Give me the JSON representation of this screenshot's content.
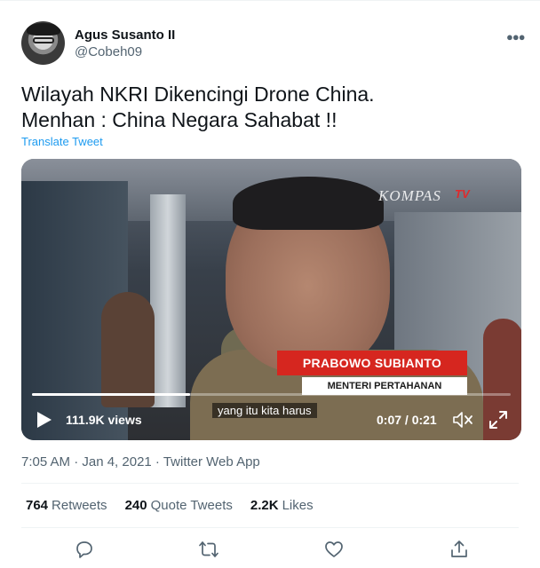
{
  "author": {
    "display_name": "Agus Susanto II",
    "handle": "@Cobeh09",
    "more_icon": "more-horizontal-icon"
  },
  "tweet": {
    "text": "Wilayah NKRI Dikencingi Drone China.\nMenhan : China Negara Sahabat !!",
    "translate_label": "Translate Tweet"
  },
  "video": {
    "channel_logo": "KOMPAS",
    "channel_logo_suffix": "TV",
    "lower_third_name": "PRABOWO SUBIANTO",
    "lower_third_title": "MENTERI PERTAHANAN",
    "caption": "yang itu kita harus",
    "views": "111.9K views",
    "time": "0:07 / 0:21",
    "progress_fraction": 0.33
  },
  "meta": {
    "timestamp": "7:05 AM · Jan 4, 2021 · Twitter Web App"
  },
  "stats": [
    {
      "count": "764",
      "label": "Retweets"
    },
    {
      "count": "240",
      "label": "Quote Tweets"
    },
    {
      "count": "2.2K",
      "label": "Likes"
    }
  ],
  "actions": [
    "reply-icon",
    "retweet-icon",
    "like-icon",
    "share-icon"
  ],
  "colors": {
    "accent": "#1d9bf0",
    "secondary_text": "#536471",
    "lower_third_red": "#d6261f"
  }
}
